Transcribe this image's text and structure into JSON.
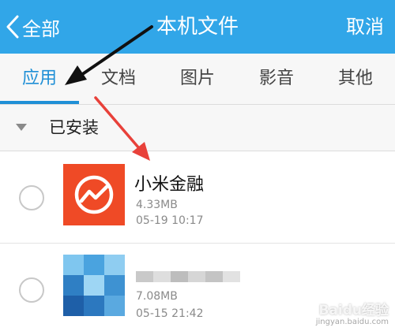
{
  "header": {
    "back_label": "全部",
    "title": "本机文件",
    "cancel_label": "取消",
    "background_color": "#31a6e8"
  },
  "tabs": [
    {
      "label": "应用",
      "active": true
    },
    {
      "label": "文档",
      "active": false
    },
    {
      "label": "图片",
      "active": false
    },
    {
      "label": "影音",
      "active": false
    },
    {
      "label": "其他",
      "active": false
    }
  ],
  "section": {
    "title": "已安装",
    "icon": "caret-down-icon"
  },
  "apps": [
    {
      "name": "小米金融",
      "size": "4.33MB",
      "date": "05-19 10:17",
      "icon": "xiaomi-finance-icon",
      "icon_color": "#ef4a26",
      "selected": false
    },
    {
      "name": "",
      "size": "7.08MB",
      "date": "05-15 21:42",
      "icon": "blurred-app-icon",
      "selected": false
    }
  ],
  "watermark": {
    "main": "Baidu经验",
    "sub": "jingyan.baidu.com"
  },
  "annotation_colors": {
    "black_arrow": "#111111",
    "red_arrow": "#e8413a"
  }
}
